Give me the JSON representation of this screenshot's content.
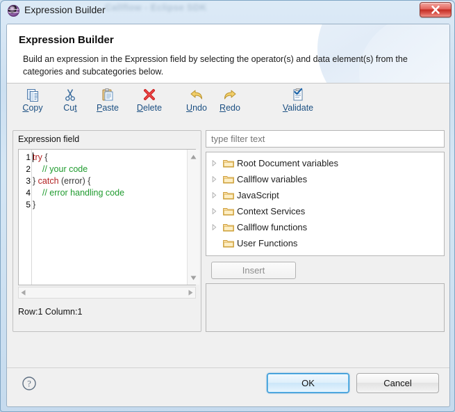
{
  "window": {
    "title": "Expression Builder",
    "ghost_title": "Callflow - Eclipse SDK",
    "icon": "eclipse-sphere-icon",
    "close_label": "x"
  },
  "header": {
    "title": "Expression Builder",
    "description": "Build an expression in the Expression field by selecting the operator(s) and data element(s) from the categories and subcategories below."
  },
  "toolbar": {
    "items": [
      {
        "label": "Copy",
        "mnemonic": "C",
        "icon": "copy-icon",
        "name": "copy-button"
      },
      {
        "label": "Cut",
        "mnemonic": "t",
        "icon": "cut-icon",
        "name": "cut-button"
      },
      {
        "label": "Paste",
        "mnemonic": "P",
        "icon": "paste-icon",
        "name": "paste-button"
      },
      {
        "label": "Delete",
        "mnemonic": "D",
        "icon": "delete-icon",
        "name": "delete-button"
      },
      {
        "label": "Undo",
        "mnemonic": "U",
        "icon": "undo-icon",
        "name": "undo-button"
      },
      {
        "label": "Redo",
        "mnemonic": "R",
        "icon": "redo-icon",
        "name": "redo-button"
      },
      {
        "label": "Validate",
        "mnemonic": "V",
        "icon": "validate-icon",
        "name": "validate-button"
      }
    ]
  },
  "expression": {
    "group_label": "Expression field",
    "line_numbers": [
      "1",
      "2",
      "3",
      "4",
      "5"
    ],
    "code_lines": [
      [
        {
          "t": "try ",
          "c": "kw"
        },
        {
          "t": "{",
          "c": "pn"
        }
      ],
      [
        {
          "t": "    // your code",
          "c": "cm"
        }
      ],
      [
        {
          "t": "} ",
          "c": "pn"
        },
        {
          "t": "catch ",
          "c": "kw"
        },
        {
          "t": "(error) {",
          "c": "pn"
        }
      ],
      [
        {
          "t": "    // error handling code",
          "c": "cm"
        }
      ],
      [
        {
          "t": "}",
          "c": "pn"
        }
      ]
    ],
    "status": "Row:1 Column:1",
    "scroll_up_icon": "triangle-up-icon",
    "scroll_down_icon": "triangle-down-icon",
    "scroll_left_icon": "triangle-left-icon",
    "scroll_right_icon": "triangle-right-icon"
  },
  "filter": {
    "placeholder": "type filter text",
    "value": ""
  },
  "tree": {
    "items": [
      {
        "label": "Root Document variables",
        "expandable": true,
        "icon": "folder-icon"
      },
      {
        "label": "Callflow variables",
        "expandable": true,
        "icon": "folder-icon"
      },
      {
        "label": "JavaScript",
        "expandable": true,
        "icon": "folder-icon"
      },
      {
        "label": "Context Services",
        "expandable": true,
        "icon": "folder-icon"
      },
      {
        "label": "Callflow functions",
        "expandable": true,
        "icon": "folder-icon"
      },
      {
        "label": "User Functions",
        "expandable": false,
        "icon": "folder-icon"
      }
    ]
  },
  "insert": {
    "label": "Insert",
    "enabled": false
  },
  "description_panel": {
    "text": ""
  },
  "buttons": {
    "help_icon": "help-question-icon",
    "ok": "OK",
    "cancel": "Cancel"
  },
  "colors": {
    "keyword": "#b22222",
    "comment": "#1f9b2e",
    "punctuation": "#3a3a3a",
    "toolbar_label": "#1b4f82",
    "default_button_border": "#2f8fd0",
    "folder": "#f5c97a"
  }
}
